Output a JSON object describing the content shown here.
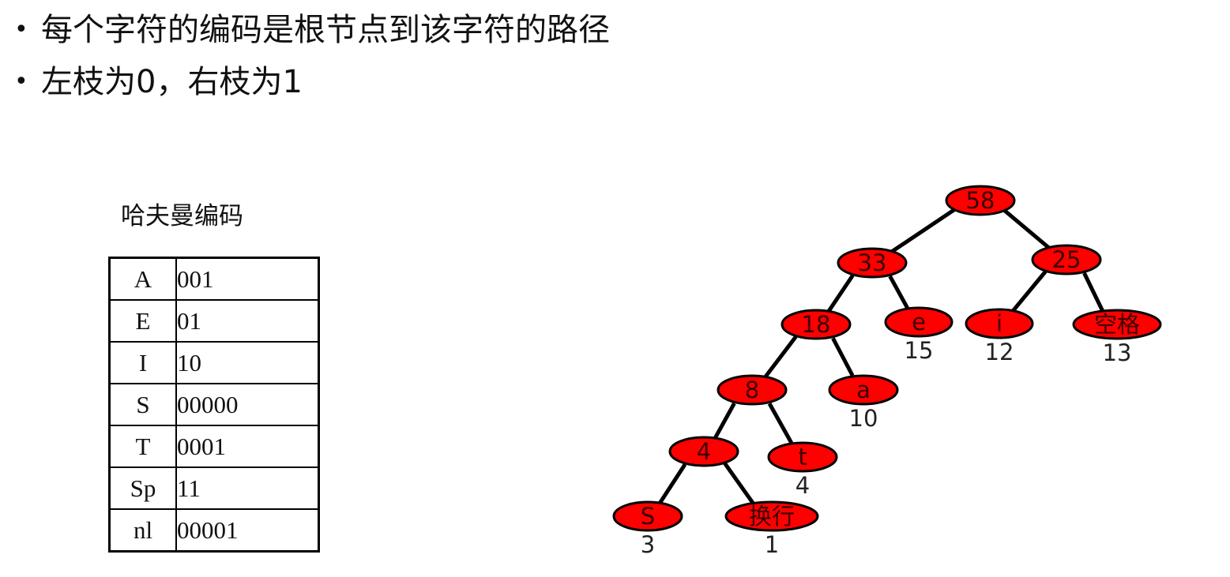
{
  "bullets": [
    {
      "marker": "•",
      "text": "每个字符的编码是根节点到该字符的路径"
    },
    {
      "marker": "•",
      "text": "左枝为0，右枝为1"
    }
  ],
  "table": {
    "caption": "哈夫曼编码",
    "rows": [
      {
        "symbol": "A",
        "code": "001"
      },
      {
        "symbol": "E",
        "code": "01"
      },
      {
        "symbol": "I",
        "code": "10"
      },
      {
        "symbol": "S",
        "code": "00000"
      },
      {
        "symbol": "T",
        "code": "0001"
      },
      {
        "symbol": "Sp",
        "code": "11"
      },
      {
        "symbol": "nl",
        "code": "00001"
      }
    ]
  },
  "tree": {
    "node_color": "#ff0000",
    "edge_color": "#000000",
    "nodes": [
      {
        "id": "n58",
        "label": "58",
        "weight": ""
      },
      {
        "id": "n33",
        "label": "33",
        "weight": ""
      },
      {
        "id": "n25",
        "label": "25",
        "weight": ""
      },
      {
        "id": "n18",
        "label": "18",
        "weight": ""
      },
      {
        "id": "ne",
        "label": "e",
        "weight": "15"
      },
      {
        "id": "ni",
        "label": "i",
        "weight": "12"
      },
      {
        "id": "nsp",
        "label": "空格",
        "weight": "13"
      },
      {
        "id": "n8",
        "label": "8",
        "weight": ""
      },
      {
        "id": "na",
        "label": "a",
        "weight": "10"
      },
      {
        "id": "n4",
        "label": "4",
        "weight": ""
      },
      {
        "id": "nt",
        "label": "t",
        "weight": "4"
      },
      {
        "id": "ns",
        "label": "S",
        "weight": "3"
      },
      {
        "id": "nnl",
        "label": "换行",
        "weight": "1"
      }
    ],
    "edges": [
      [
        "n58",
        "n33"
      ],
      [
        "n58",
        "n25"
      ],
      [
        "n33",
        "n18"
      ],
      [
        "n33",
        "ne"
      ],
      [
        "n25",
        "ni"
      ],
      [
        "n25",
        "nsp"
      ],
      [
        "n18",
        "n8"
      ],
      [
        "n18",
        "na"
      ],
      [
        "n8",
        "n4"
      ],
      [
        "n8",
        "nt"
      ],
      [
        "n4",
        "ns"
      ],
      [
        "n4",
        "nnl"
      ]
    ]
  }
}
